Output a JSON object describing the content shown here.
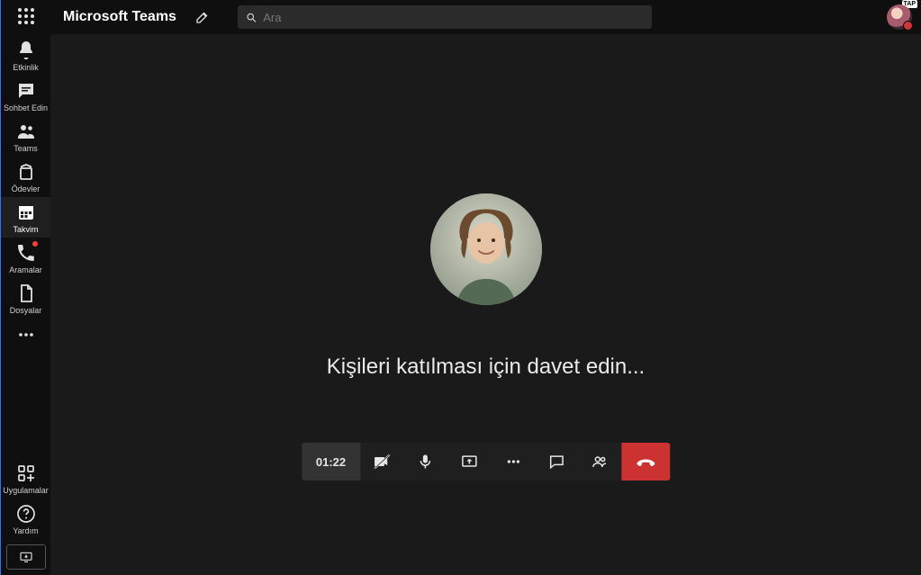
{
  "header": {
    "appTitle": "Microsoft Teams",
    "search": {
      "placeholder": "Ara"
    },
    "profileTag": "TAP"
  },
  "rail": {
    "items": [
      {
        "key": "activity",
        "label": "Etkinlik"
      },
      {
        "key": "chat",
        "label": "Sohbet Edin"
      },
      {
        "key": "teams",
        "label": "Teams"
      },
      {
        "key": "assign",
        "label": "Ödevler"
      },
      {
        "key": "calendar",
        "label": "Takvim"
      },
      {
        "key": "calls",
        "label": "Aramalar"
      },
      {
        "key": "files",
        "label": "Dosyalar"
      }
    ],
    "bottom": {
      "apps": {
        "label": "Uygulamalar"
      },
      "help": {
        "label": "Yardım"
      }
    }
  },
  "meeting": {
    "inviteText": "Kişileri katılması için davet edin...",
    "timer": "01:22"
  }
}
